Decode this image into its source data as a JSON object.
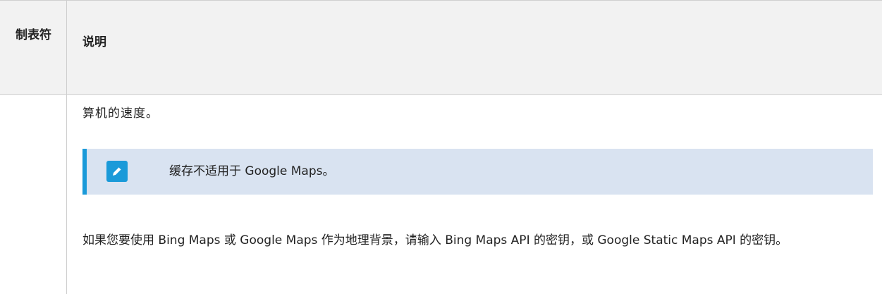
{
  "table": {
    "headers": {
      "col1": "制表符",
      "col2": "说明"
    },
    "row": {
      "paragraph1": "算机的速度。",
      "note": {
        "icon": "pencil-icon",
        "text": "缓存不适用于 Google Maps。"
      },
      "paragraph2": "如果您要使用 Bing Maps 或 Google Maps 作为地理背景，请输入 Bing Maps API 的密钥，或 Google Static Maps API 的密钥。"
    }
  },
  "colors": {
    "header_bg": "#f2f2f2",
    "note_bg": "#d9e3f1",
    "accent": "#1a9ad9"
  }
}
